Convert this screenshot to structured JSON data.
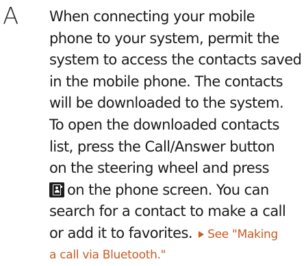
{
  "faq": {
    "answer_marker": "A",
    "lines": [
      "When connecting your mobile",
      "phone to your system, permit the",
      "system to access the contacts saved",
      "in the mobile phone. The contacts",
      "will be downloaded to the system.",
      "To open the downloaded contacts",
      "list, press the Call/Answer button",
      "on the steering wheel and press",
      "on the phone screen. You can",
      "search for a contact to make a call",
      "or add it to favorites.",
      "a call via Bluetooth.\""
    ],
    "crossref_lead": "See \"Making",
    "icon": "contacts-icon",
    "crossref_icon": "triangle-right-icon",
    "colors": {
      "text": "#1a1a1a",
      "crossref": "#c85a22"
    }
  }
}
